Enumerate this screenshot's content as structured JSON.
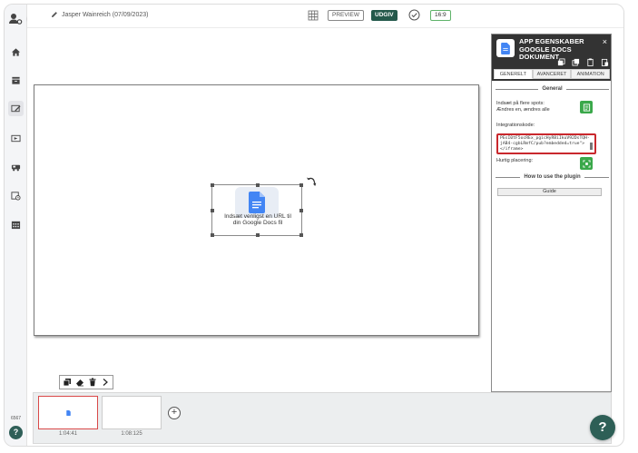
{
  "topbar": {
    "author": "Jasper Wainreich (07/09/2023)",
    "preview_label": "PREVIEW",
    "publish_label": "UDGIV",
    "aspect_ratio": "16:9"
  },
  "rail": {
    "items": [
      "home-icon",
      "inbox-icon",
      "edit-slide-icon",
      "media-icon",
      "transport-icon",
      "schedule-icon",
      "calendar-icon"
    ],
    "count": "6567",
    "help_label": "?"
  },
  "canvas": {
    "widget_text_line1": "Indsæt venligst en URL til",
    "widget_text_line2": "din Google Docs fil"
  },
  "panel": {
    "title_line1": "APP EGENSKABER",
    "title_line2": "GOOGLE DOCS DOKUMENT",
    "close_label": "×",
    "tabs": [
      "GENERELT",
      "AVANCERET",
      "ANIMATION"
    ],
    "section_general": "General",
    "multi_label_line1": "Indsæt på flere spots:",
    "multi_label_line2": "Ændres en, ændres alle",
    "integration_label": "Integrationskode:",
    "integration_code": "PEsI0tF5ocREx_pgicHyR8iIkuV92DsTQH-jAB4-cgbLRmfC/pub?embedded=true\"></iframe>",
    "quick_placement_label": "Hurtig placering:",
    "section_howto": "How to use the plugin",
    "guide_label": "Guide"
  },
  "filmstrip": {
    "slides": [
      {
        "duration": "1:04:41"
      },
      {
        "duration": "1:08:125"
      }
    ],
    "add_label": "+"
  },
  "help_fab_label": "?",
  "colors": {
    "publish": "#24594b",
    "accent_green": "#3aa84a",
    "highlight_red": "#c9282d",
    "docs_blue": "#4285f4",
    "panel_header": "#333333"
  }
}
